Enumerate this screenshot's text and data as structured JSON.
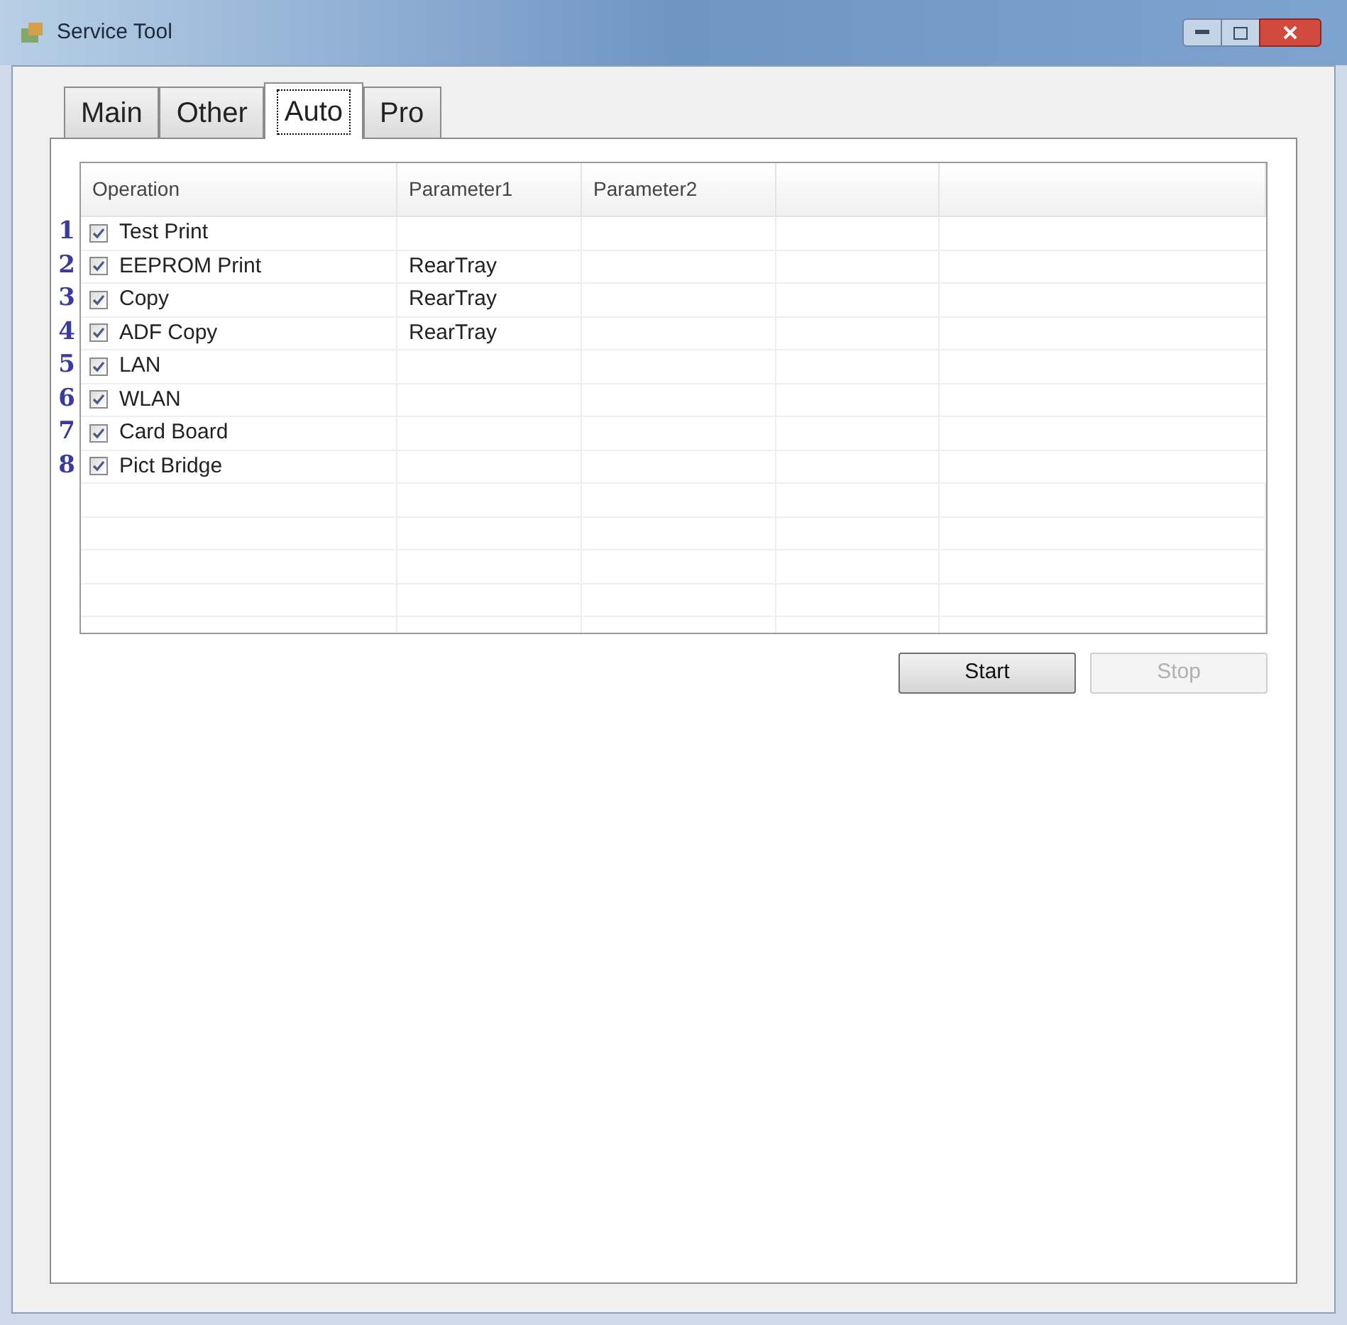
{
  "window": {
    "title": "Service Tool"
  },
  "tabs": [
    {
      "label": "Main",
      "selected": false
    },
    {
      "label": "Other",
      "selected": false
    },
    {
      "label": "Auto",
      "selected": true
    },
    {
      "label": "Pro",
      "selected": false
    }
  ],
  "table": {
    "columns": [
      "Operation",
      "Parameter1",
      "Parameter2"
    ],
    "rows": [
      {
        "number": "1",
        "checked": true,
        "operation": "Test Print",
        "parameter1": ""
      },
      {
        "number": "2",
        "checked": true,
        "operation": "EEPROM Print",
        "parameter1": "RearTray"
      },
      {
        "number": "3",
        "checked": true,
        "operation": "Copy",
        "parameter1": "RearTray"
      },
      {
        "number": "4",
        "checked": true,
        "operation": "ADF Copy",
        "parameter1": "RearTray"
      },
      {
        "number": "5",
        "checked": true,
        "operation": "LAN",
        "parameter1": ""
      },
      {
        "number": "6",
        "checked": true,
        "operation": "WLAN",
        "parameter1": ""
      },
      {
        "number": "7",
        "checked": true,
        "operation": "Card Board",
        "parameter1": ""
      },
      {
        "number": "8",
        "checked": true,
        "operation": "Pict Bridge",
        "parameter1": ""
      }
    ]
  },
  "buttons": [
    {
      "label": "Start",
      "disabled": false
    },
    {
      "label": "Stop",
      "disabled": true
    }
  ]
}
